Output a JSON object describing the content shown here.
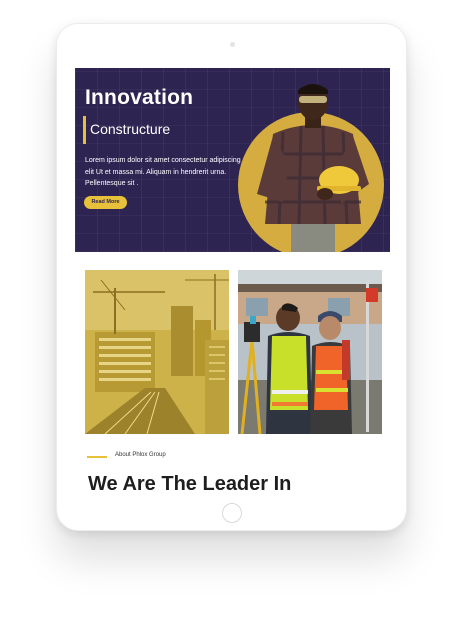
{
  "hero": {
    "title": "Innovation",
    "subtitle": "Constructure",
    "body": "Lorem ipsum dolor sit amet consectetur adipiscing elit Ut et massa mi. Aliquam in hendrerit urna. Pellentesque sit .",
    "button_label": "Read More"
  },
  "about": {
    "label": "About Phlox Group",
    "heading": "We Are The Leader In"
  },
  "colors": {
    "hero_bg": "#2e2452",
    "accent": "#e8c13a",
    "circle": "#d4ac3f"
  }
}
